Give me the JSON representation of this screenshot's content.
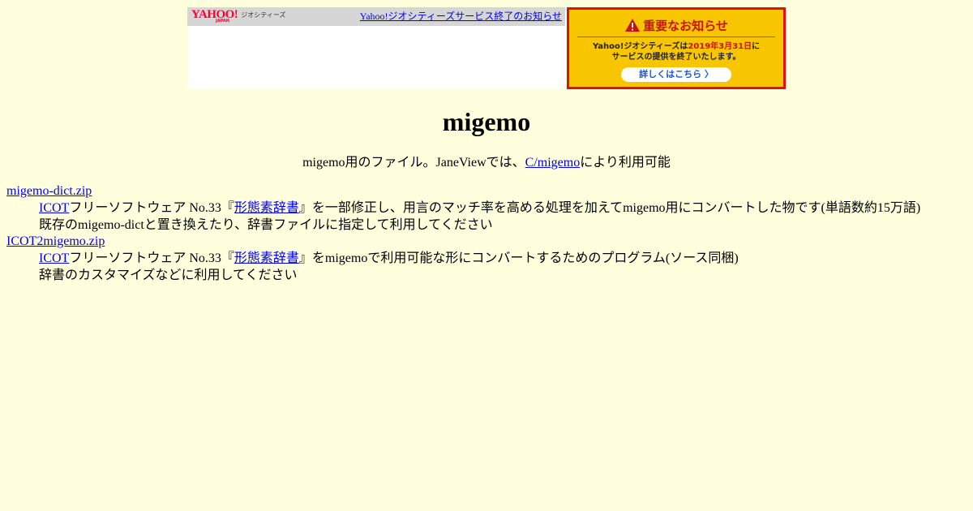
{
  "banner": {
    "logo_text": "YAHOO!",
    "logo_sub": "JAPAN",
    "service_name": "ジオシティーズ",
    "top_link": "Yahoo!ジオシティーズサービス終了のお知らせ",
    "notice": {
      "heading": "重要なお知らせ",
      "line1_pre": "Yahoo!ジオシティーズは",
      "line1_date": "2019年3月31日",
      "line1_post": "に",
      "line2": "サービスの提供を終了いたします。",
      "button": "詳しくはこちら 〉",
      "colors": {
        "background": "#f7c600",
        "border": "#dd1111",
        "heading": "#cc1111"
      }
    }
  },
  "page": {
    "title": "migemo",
    "intro_pre": "migemo用のファイル。JaneViewでは、",
    "intro_link": "C/migemo",
    "intro_post": "により利用可能",
    "background": "#ffffdd"
  },
  "files": [
    {
      "name": "migemo-dict.zip",
      "desc1_link1": "ICOT",
      "desc1_mid": "フリーソフトウェア No.33『",
      "desc1_link2": "形態素辞書",
      "desc1_post": "』を一部修正し、用言のマッチ率を高める処理を加えてmigemo用にコンバートした物です(単語数約15万語)",
      "desc2": "既存のmigemo-dictと置き換えたり、辞書ファイルに指定して利用してください"
    },
    {
      "name": "ICOT2migemo.zip",
      "desc1_link1": "ICOT",
      "desc1_mid": "フリーソフトウェア No.33『",
      "desc1_link2": "形態素辞書",
      "desc1_post": "』をmigemoで利用可能な形にコンバートするためのプログラム(ソース同梱)",
      "desc2": "辞書のカスタマイズなどに利用してください"
    }
  ]
}
